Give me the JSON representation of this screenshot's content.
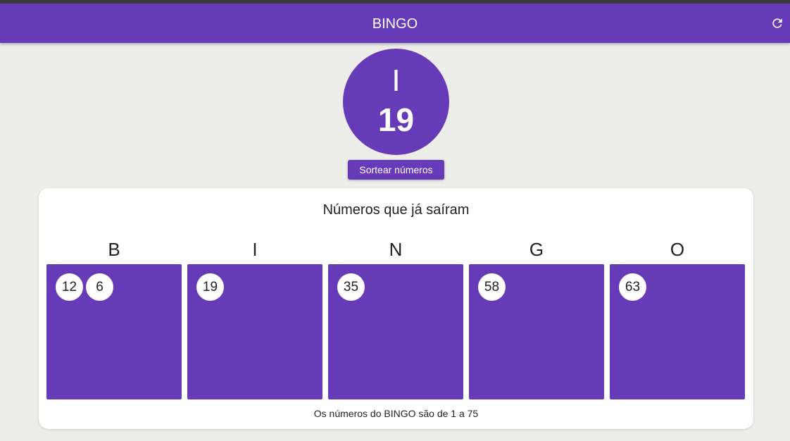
{
  "appbar": {
    "title": "BINGO",
    "refresh_icon": "refresh-icon"
  },
  "current_draw": {
    "letter": "I",
    "number": "19"
  },
  "draw_button": {
    "label": "Sortear números"
  },
  "drawn_panel": {
    "heading": "Números que já saíram",
    "columns": [
      {
        "letter": "B",
        "numbers": [
          "12",
          "6"
        ]
      },
      {
        "letter": "I",
        "numbers": [
          "19"
        ]
      },
      {
        "letter": "N",
        "numbers": [
          "35"
        ]
      },
      {
        "letter": "G",
        "numbers": [
          "58"
        ]
      },
      {
        "letter": "O",
        "numbers": [
          "63"
        ]
      }
    ],
    "footer": "Os números do BINGO são de 1 a 75"
  },
  "colors": {
    "primary": "#673ab7",
    "background": "#ededea",
    "card": "#ffffff"
  }
}
